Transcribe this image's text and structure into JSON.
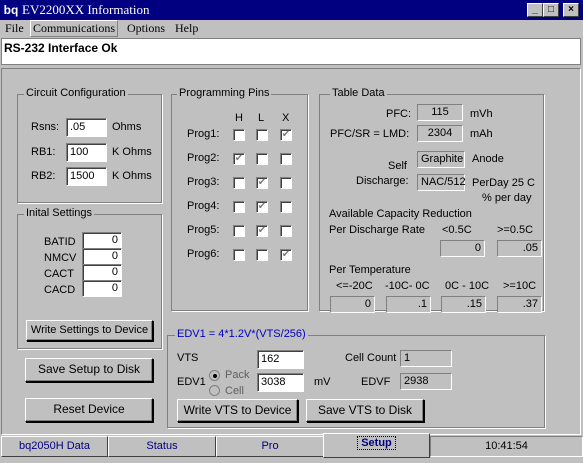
{
  "window": {
    "title": "EV2200XX Information",
    "app_icon": "bq",
    "controls": {
      "minimize": "_",
      "maximize": "□",
      "close": "×"
    }
  },
  "menu": [
    "File",
    "Communications",
    "Options",
    "Help"
  ],
  "status_message": "RS-232 Interface Ok",
  "circuit_config": {
    "title": "Circuit Configuration",
    "rows": [
      {
        "label": "Rsns:",
        "value": ".05",
        "unit": "Ohms"
      },
      {
        "label": "RB1:",
        "value": "100",
        "unit": "K Ohms"
      },
      {
        "label": "RB2:",
        "value": "1500",
        "unit": "K Ohms"
      }
    ]
  },
  "initial_settings": {
    "title": "Inital Settings",
    "rows": [
      {
        "label": "BATID",
        "value": "0"
      },
      {
        "label": "NMCV",
        "value": "0"
      },
      {
        "label": "CACT",
        "value": "0"
      },
      {
        "label": "CACD",
        "value": "0"
      }
    ],
    "write_button": "Write Settings to Device"
  },
  "programming_pins": {
    "title": "Programming Pins",
    "columns": [
      "H",
      "L",
      "X"
    ],
    "rows": [
      {
        "label": "Prog1:",
        "checks": [
          false,
          false,
          true
        ]
      },
      {
        "label": "Prog2:",
        "checks": [
          true,
          false,
          false
        ]
      },
      {
        "label": "Prog3:",
        "checks": [
          false,
          true,
          false
        ]
      },
      {
        "label": "Prog4:",
        "checks": [
          false,
          true,
          false
        ]
      },
      {
        "label": "Prog5:",
        "checks": [
          false,
          true,
          false
        ]
      },
      {
        "label": "Prog6:",
        "checks": [
          false,
          false,
          true
        ]
      }
    ]
  },
  "table_data": {
    "title": "Table Data",
    "pfc": {
      "label": "PFC:",
      "value": "115",
      "unit": "mVh"
    },
    "pfc_sr": {
      "label": "PFC/SR = LMD:",
      "value": "2304",
      "unit": "mAh"
    },
    "self_discharge_label_1": "Self",
    "self_discharge_label_2": "Discharge:",
    "chemistry": "Graphite",
    "anode": "Anode",
    "nac_rate": "NAC/512",
    "perday_1": "PerDay 25 C",
    "perday_2": "% per day",
    "capacity_reduction": "Available Capacity Reduction",
    "per_discharge_rate": "Per Discharge Rate",
    "rate_headers": [
      "<0.5C",
      ">=0.5C"
    ],
    "rate_values": [
      "0",
      ".05"
    ],
    "per_temperature": "Per Temperature",
    "temp_headers": [
      "<=-20C",
      "-10C- 0C",
      "0C - 10C",
      ">=10C"
    ],
    "temp_values": [
      "0",
      ".1",
      ".15",
      ".37"
    ]
  },
  "edv": {
    "title": "EDV1 = 4*1.2V*(VTS/256)",
    "vts_label": "VTS",
    "vts_value": "162",
    "edv1_label": "EDV1",
    "pack_label": "Pack",
    "cell_label": "Cell",
    "edv1_value": "3038",
    "edv1_unit": "mV",
    "cell_count_label": "Cell Count",
    "cell_count_value": "1",
    "edvf_label": "EDVF",
    "edvf_value": "2938",
    "write_vts_button": "Write VTS to Device",
    "save_vts_button": "Save  VTS to Disk"
  },
  "buttons": {
    "save_setup": "Save Setup to Disk",
    "reset_device": "Reset Device"
  },
  "tabs": [
    "bq2050H Data",
    "Status",
    "Pro",
    "Setup"
  ],
  "active_tab": "Setup",
  "clock": "10:41:54"
}
